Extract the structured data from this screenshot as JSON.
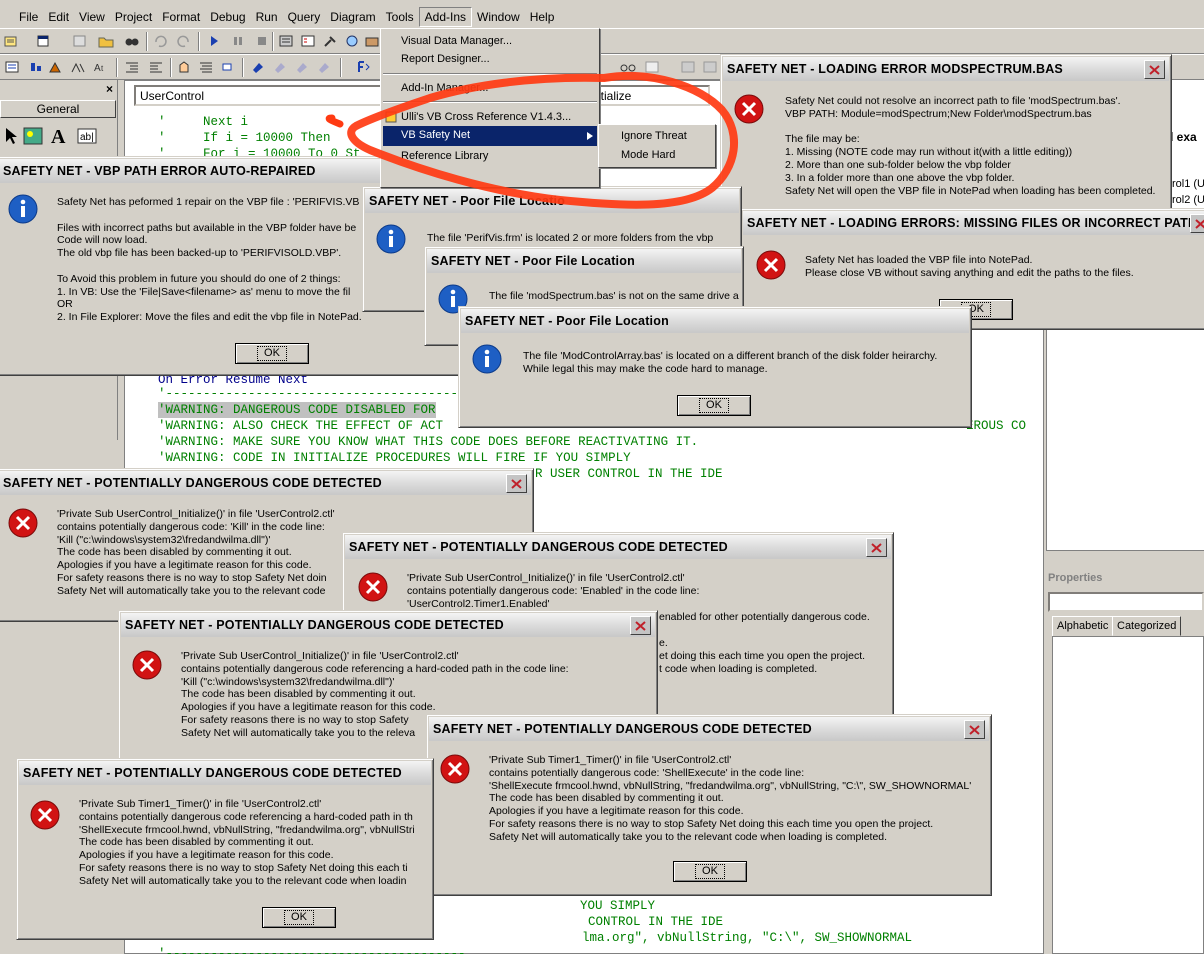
{
  "menubar": {
    "items": [
      "File",
      "Edit",
      "View",
      "Project",
      "Format",
      "Debug",
      "Run",
      "Query",
      "Diagram",
      "Tools",
      "Add-Ins",
      "Window",
      "Help"
    ],
    "active": "Add-Ins"
  },
  "toolbox": {
    "close": "×",
    "tab": "General"
  },
  "code_window": {
    "object_combo": "UserControl",
    "proc_combo": "itialize",
    "lines": {
      "l1": "'     Next i",
      "l2": "'     If i = 10000 Then",
      "l3": "'     For i = 10000 To 0 St",
      "l4": "On Error Resume Next",
      "l5": "'--------------------------------------------------",
      "l6": "'WARNING: DANGEROUS CODE DISABLED FOR",
      "l7": "'WARNING: ALSO CHECK THE EFFECT OF ACT",
      "l7b": "EROUS CO",
      "l8": "'WARNING: MAKE SURE YOU KNOW WHAT THIS CODE DOES BEFORE REACTIVATING IT.",
      "l9": "'WARNING: CODE IN INITIALIZE PROCEDURES WILL FIRE IF YOU SIMPLY",
      "l10": "R USER CONTROL IN THE IDE",
      "b1": "YOU SIMPLY",
      "b2": "CONTROL IN THE IDE",
      "b3": "lma.org\", vbNullString, \"C:\\\", SW_SHOWNORMAL",
      "b4": "'----------------------------------------"
    }
  },
  "right_panes": {
    "project_labels": [
      "d exa",
      "rol1 (U",
      "rol2 (U"
    ],
    "properties_title": "Properties",
    "tabs": [
      "Alphabetic",
      "Categorized"
    ]
  },
  "addins_menu": {
    "items": [
      "Visual Data Manager...",
      "Report Designer...",
      "Add-In Manager...",
      "Ulli's VB Cross Reference V1.4.3...",
      "VB Safety Net",
      "Reference Library"
    ],
    "highlighted": "VB Safety Net",
    "submenu": [
      "Ignore Threat",
      "Mode Hard"
    ]
  },
  "dialogs": {
    "vbp_path": {
      "title": "SAFETY NET - VBP PATH ERROR AUTO-REPAIRED",
      "body": "Safety Net has peformed 1 repair on the VBP file : 'PERIFVIS.VB\n\nFiles with incorrect paths but available in the VBP folder have be\nCode will now load.\nThe old vbp file has been backed-up to 'PERIFVISOLD.VBP'.\n\nTo Avoid this problem in future you should do one of 2 things:\n1. In VB: Use the 'File|Save<filename> as' menu to move the fil\nOR\n2. In File Explorer: Move the files and edit the vbp file in NotePad.",
      "ok": "OK"
    },
    "loading_error": {
      "title": "SAFETY NET - LOADING ERROR MODSPECTRUM.BAS",
      "body": "Safety Net could not resolve an incorrect path to file 'modSpectrum.bas'.\nVBP PATH: Module=modSpectrum;New Folder\\modSpectrum.bas\n\nThe file may be:\n1. Missing (NOTE code may run without it(with a little editing))\n2. More than one sub-folder below the vbp folder\n3. In a folder more than one above the vbp folder.\nSafety Net will open the VBP file in NotePad when loading has been completed."
    },
    "missing_files": {
      "title": "SAFETY NET - LOADING ERRORS: MISSING FILES OR INCORRECT PATHS",
      "body": "Safety Net has loaded the VBP file into NotePad.\nPlease close VB without saving anything and edit the paths to the files.",
      "ok": "OK"
    },
    "poor1": {
      "title": "SAFETY NET - Poor File Locatio",
      "body": "The file 'PerifVis.frm' is located 2 or more folders from the vbp"
    },
    "poor2": {
      "title": "SAFETY NET -  Poor File Location",
      "body": "The file 'modSpectrum.bas' is not on the same drive a"
    },
    "poor3": {
      "title": "SAFETY NET - Poor File Location",
      "body": "The file 'ModControlArray.bas' is located on a different branch of the disk folder heirarchy.\nWhile legal this may make the code hard to manage.",
      "ok": "OK"
    },
    "danger1": {
      "title": "SAFETY NET - POTENTIALLY DANGEROUS CODE DETECTED",
      "body": "'Private Sub UserControl_Initialize()' in file 'UserControl2.ctl'\ncontains potentially dangerous code: 'Kill' in the code line:\n'Kill (\"c:\\windows\\system32\\fredandwilma.dll\")'\nThe code has been disabled by commenting it out.\nApologies if you have a legitimate reason for this code.\nFor safety reasons there is no way to stop Safety Net doin\nSafety Net will automatically take you to the relevant code"
    },
    "danger2": {
      "title": "SAFETY NET - POTENTIALLY DANGEROUS CODE DETECTED",
      "body": "'Private Sub UserControl_Initialize()' in file 'UserControl2.ctl'\ncontains potentially dangerous code: 'Enabled' in the code line:\n'UserControl2.Timer1.Enabled'",
      "frag1": "enabled for other potentially dangerous code.",
      "frag2": "e.",
      "frag3": "et doing this each time you open the project.",
      "frag4": "t code when loading is completed."
    },
    "danger3": {
      "title": "SAFETY NET - POTENTIALLY DANGEROUS CODE DETECTED",
      "body": "'Private Sub UserControl_Initialize()' in file 'UserControl2.ctl'\ncontains potentially dangerous code referencing a hard-coded path in the code line:\n'Kill (\"c:\\windows\\system32\\fredandwilma.dll\")'\nThe code has been disabled by commenting it out.\nApologies if you have a legitimate reason for this code.\nFor safety reasons there is no way to stop Safety\nSafety Net will automatically take you to the releva"
    },
    "danger4": {
      "title": "SAFETY NET - POTENTIALLY DANGEROUS CODE DETECTED",
      "body": "'Private Sub Timer1_Timer()' in file 'UserControl2.ctl'\ncontains potentially dangerous code: 'ShellExecute' in the code line:\n'ShellExecute frmcool.hwnd, vbNullString, \"fredandwilma.org\", vbNullString, \"C:\\\", SW_SHOWNORMAL'\nThe code has been disabled by commenting it out.\nApologies if you have a legitimate reason for this code.\nFor safety reasons there is no way to stop Safety Net doing this each time you open the project.\nSafety Net will automatically take you to the relevant code when loading is completed.",
      "ok": "OK"
    },
    "danger5": {
      "title": "SAFETY NET - POTENTIALLY DANGEROUS CODE DETECTED",
      "body": "'Private Sub Timer1_Timer()' in file 'UserControl2.ctl'\ncontains potentially dangerous code referencing a hard-coded path in th\n'ShellExecute frmcool.hwnd, vbNullString, \"fredandwilma.org\", vbNullStri\nThe code has been disabled by commenting it out.\nApologies if you have a legitimate reason for this code.\nFor safety reasons there is no way to stop Safety Net doing this each ti\nSafety Net will automatically take you to the relevant code when loadin",
      "ok": "OK"
    }
  },
  "colors": {
    "highlight": "#0a246a",
    "annotation_red": "#ff3a12",
    "error_red": "#d11313",
    "info_blue": "#1e5fc4"
  }
}
